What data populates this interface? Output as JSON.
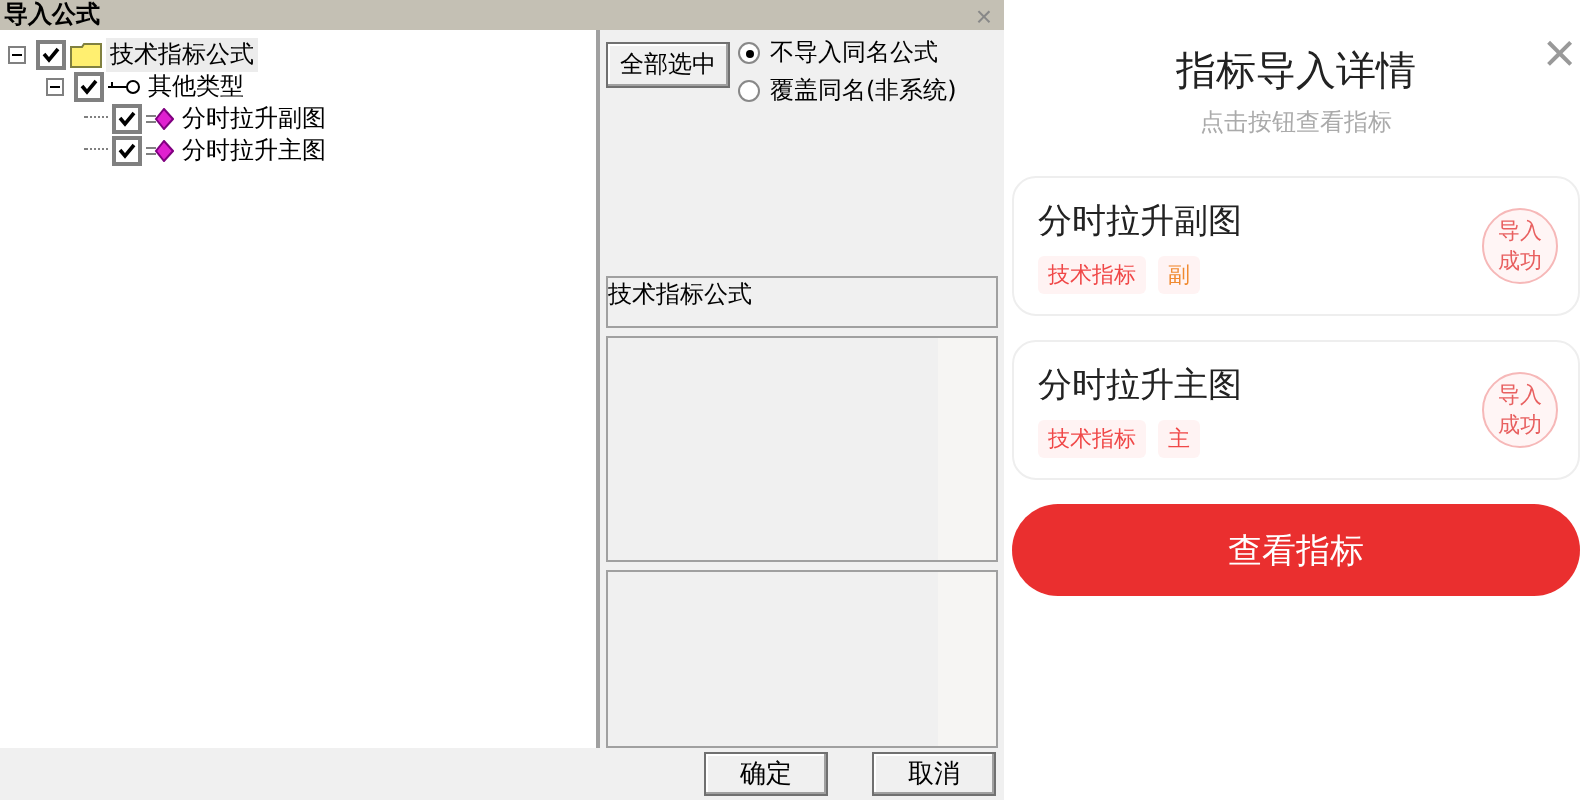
{
  "dialog": {
    "title": "导入公式",
    "close": "×",
    "tree": [
      {
        "label": "技术指标公式",
        "kind": "folder",
        "checked": true,
        "selected": true,
        "expanded": true,
        "children": [
          {
            "label": "其他类型",
            "kind": "key",
            "checked": true,
            "selected": false,
            "expanded": true,
            "children": [
              {
                "label": "分时拉升副图",
                "kind": "formula",
                "checked": true,
                "selected": false
              },
              {
                "label": "分时拉升主图",
                "kind": "formula",
                "checked": true,
                "selected": false
              }
            ]
          }
        ]
      }
    ],
    "select_all": "全部选中",
    "options": [
      {
        "label": "不导入同名公式",
        "selected": true
      },
      {
        "label": "覆盖同名(非系统)",
        "selected": false
      }
    ],
    "name_field": "技术指标公式",
    "buttons": [
      "确定",
      "取消"
    ]
  },
  "panel": {
    "title": "指标导入详情",
    "subtitle": "点击按钮查看指标",
    "close": "×",
    "items": [
      {
        "name": "分时拉升副图",
        "tags": [
          {
            "label": "技术指标",
            "color": "#f04848"
          },
          {
            "label": "副",
            "color": "#f08a30"
          }
        ],
        "status": "导入成功"
      },
      {
        "name": "分时拉升主图",
        "tags": [
          {
            "label": "技术指标",
            "color": "#f04848"
          },
          {
            "label": "主",
            "color": "#f04848"
          }
        ],
        "status": "导入成功"
      }
    ],
    "button": "查看指标"
  }
}
